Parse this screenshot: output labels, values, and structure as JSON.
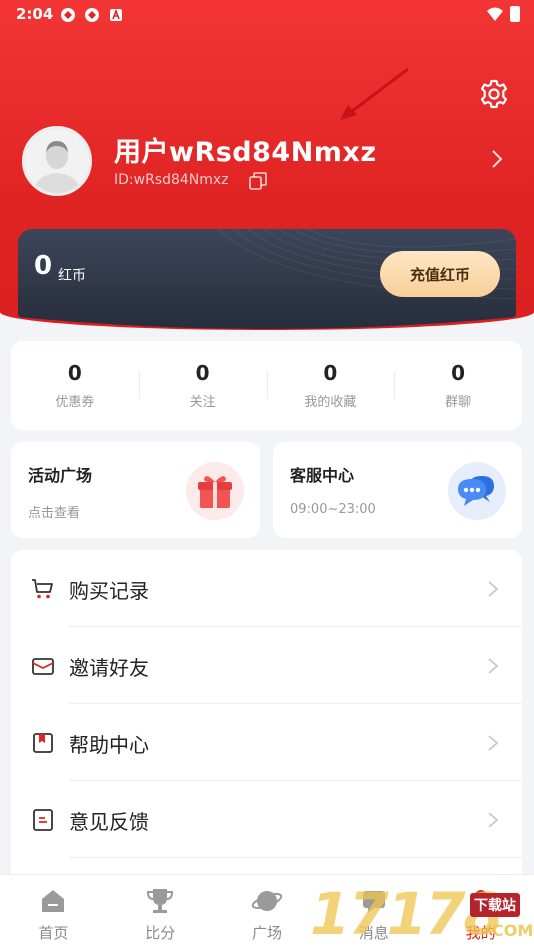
{
  "status": {
    "time": "2:04"
  },
  "profile": {
    "username": "用户wRsd84Nmxz",
    "user_id": "ID:wRsd84Nmxz"
  },
  "wallet": {
    "balance": "0",
    "unit": "红币",
    "recharge_label": "充值红币"
  },
  "stats": [
    {
      "value": "0",
      "label": "优惠券"
    },
    {
      "value": "0",
      "label": "关注"
    },
    {
      "value": "0",
      "label": "我的收藏"
    },
    {
      "value": "0",
      "label": "群聊"
    }
  ],
  "promos": {
    "activity": {
      "title": "活动广场",
      "subtitle": "点击查看",
      "icon": "gift-icon"
    },
    "service": {
      "title": "客服中心",
      "subtitle": "09:00~23:00",
      "icon": "chat-bubble-icon"
    }
  },
  "menu": [
    {
      "label": "购买记录",
      "icon": "cart-icon"
    },
    {
      "label": "邀请好友",
      "icon": "envelope-icon"
    },
    {
      "label": "帮助中心",
      "icon": "bookmark-book-icon"
    },
    {
      "label": "意见反馈",
      "icon": "feedback-icon"
    }
  ],
  "tabbar": [
    {
      "label": "首页",
      "icon": "home-icon",
      "active": false
    },
    {
      "label": "比分",
      "icon": "trophy-icon",
      "active": false
    },
    {
      "label": "广场",
      "icon": "planet-icon",
      "active": false
    },
    {
      "label": "消息",
      "icon": "message-icon",
      "active": false
    },
    {
      "label": "我的",
      "icon": "profile-icon",
      "active": true
    }
  ],
  "watermark": {
    "brand": "17178",
    "tag": "下载站",
    "suffix": "COM"
  },
  "colors": {
    "accent": "#e02424",
    "card_dark": "#2b3242",
    "recharge_button": "#f9d7a6"
  }
}
